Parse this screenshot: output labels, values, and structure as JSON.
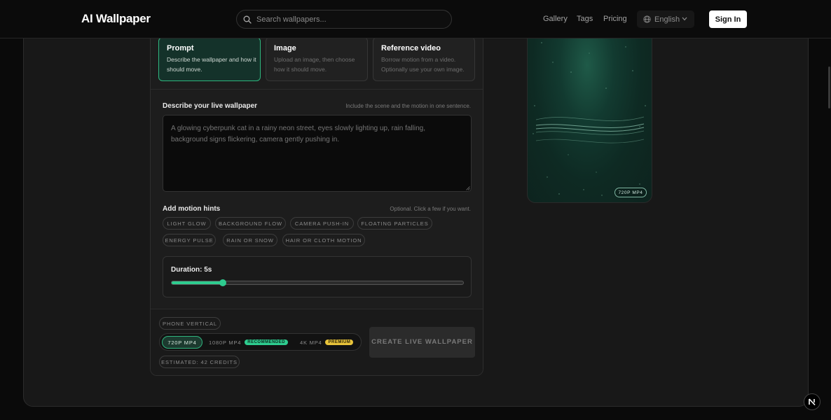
{
  "header": {
    "logo": "AI Wallpaper",
    "search_placeholder": "Search wallpapers...",
    "nav": [
      "Gallery",
      "Tags",
      "Pricing"
    ],
    "language": "English",
    "sign_in": "Sign In"
  },
  "modes": [
    {
      "title": "Prompt",
      "desc": "Describe the wallpaper and how it should move.",
      "active": true
    },
    {
      "title": "Image",
      "desc": "Upload an image, then choose how it should move.",
      "active": false
    },
    {
      "title": "Reference video",
      "desc": "Borrow motion from a video. Optionally use your own image.",
      "active": false
    }
  ],
  "describe": {
    "title": "Describe your live wallpaper",
    "hint": "Include the scene and the motion in one sentence.",
    "placeholder": "A glowing cyberpunk cat in a rainy neon street, eyes slowly lighting up, rain falling, background signs flickering, camera gently pushing in."
  },
  "motion": {
    "title": "Add motion hints",
    "hint": "Optional. Click a few if you want.",
    "chips": [
      "Light glow",
      "Background flow",
      "Camera push-in",
      "Floating particles",
      "Energy pulse",
      "Rain or snow",
      "Hair or cloth motion"
    ]
  },
  "duration": {
    "label": "Duration: 5s",
    "fraction": 0.175
  },
  "output": {
    "orientation": "Phone vertical",
    "resolutions": [
      {
        "label": "720P MP4",
        "badge": "",
        "active": true
      },
      {
        "label": "1080P MP4",
        "badge": "RECOMMENDED",
        "active": false
      },
      {
        "label": "4K MP4",
        "badge": "PREMIUM",
        "active": false
      }
    ],
    "estimate": "Estimated: 42 credits",
    "create": "Create live wallpaper"
  },
  "preview": {
    "badge": "720P MP4"
  },
  "colors": {
    "accent": "#2ecc8f",
    "premium": "#e8c33a",
    "background": "#0a0a0a"
  }
}
